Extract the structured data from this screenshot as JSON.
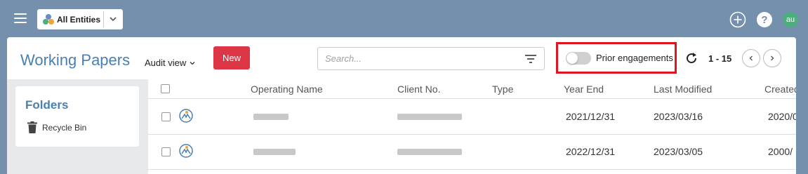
{
  "topbar": {
    "entity_select": {
      "label": "All Entities"
    },
    "avatar_initials": "au",
    "help_glyph": "?"
  },
  "page": {
    "title": "Working Papers",
    "view_label": "Audit view",
    "new_button": "New",
    "search_placeholder": "Search...",
    "prior_engagements_label": "Prior engagements",
    "prior_engagements_enabled": false,
    "range_label": "1 - 15"
  },
  "sidebar": {
    "folders_title": "Folders",
    "recycle_bin_label": "Recycle Bin"
  },
  "table": {
    "columns": [
      "Operating Name",
      "Client No.",
      "Type",
      "Year End",
      "Last Modified",
      "Created"
    ],
    "rows": [
      {
        "year_end": "2021/12/31",
        "last_modified": "2023/03/16",
        "created": "2020/0"
      },
      {
        "year_end": "2022/12/31",
        "last_modified": "2023/03/05",
        "created": "2000/"
      }
    ]
  },
  "colors": {
    "background": "#7590ac",
    "accent": "#4a7fb0",
    "new_button": "#dc3545",
    "highlight_border": "#e0131f",
    "avatar": "#4caf7d"
  },
  "icons": [
    "menu-icon",
    "entities-icon",
    "chevron-down-icon",
    "plus-circle-icon",
    "help-icon",
    "filter-icon",
    "refresh-icon",
    "chevron-left-icon",
    "chevron-right-icon",
    "trash-icon",
    "engagement-icon"
  ]
}
